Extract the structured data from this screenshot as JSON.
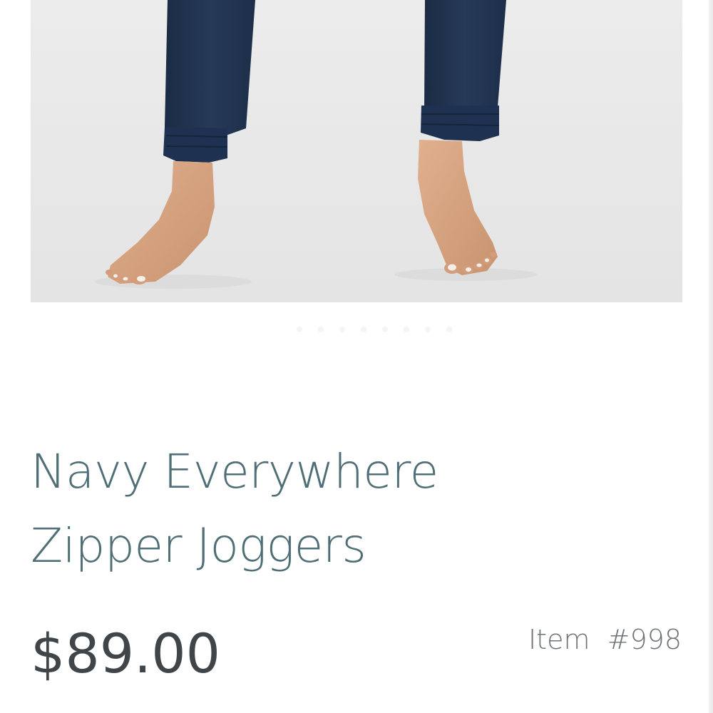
{
  "product": {
    "image_alt": "Navy Everywhere Zipper Joggers",
    "title_line1": "Navy Everywhere",
    "title_line2": "Zipper Joggers",
    "price": "$89.00",
    "item_label": "Item  #998"
  },
  "carousel": {
    "slide_count": 8,
    "active_index": 0
  },
  "colors": {
    "title": "#4f6e75",
    "price": "#3f4549",
    "item_label": "#6e7478",
    "pants": "#22344f",
    "background": "#e9e9e9",
    "skin": "#d9a988"
  }
}
